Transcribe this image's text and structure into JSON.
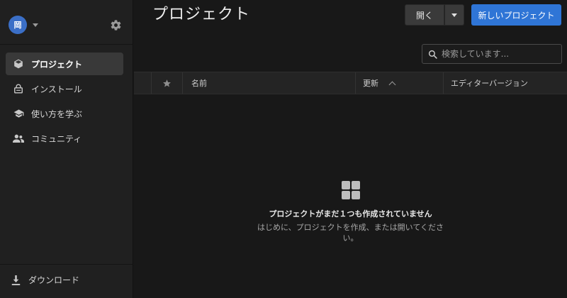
{
  "window": {
    "traffic_colors": [
      "#ff5f57",
      "#febc2e",
      "#28c840"
    ]
  },
  "account": {
    "avatar_initial": "岡",
    "avatar_color": "#3b6fc7"
  },
  "sidebar": {
    "items": [
      {
        "label": "プロジェクト",
        "icon": "cube-icon",
        "active": true
      },
      {
        "label": "インストール",
        "icon": "lock-icon",
        "active": false
      },
      {
        "label": "使い方を学ぶ",
        "icon": "graduation-cap-icon",
        "active": false
      },
      {
        "label": "コミュニティ",
        "icon": "people-icon",
        "active": false
      }
    ],
    "download_label": "ダウンロード"
  },
  "main": {
    "title": "プロジェクト",
    "open_label": "開く",
    "new_project_label": "新しいプロジェクト",
    "search_placeholder": "検索しています...",
    "columns": {
      "name": "名前",
      "updated": "更新",
      "editor_version": "エディターバージョン"
    },
    "empty_title": "プロジェクトがまだ１つも作成されていません",
    "empty_subtitle": "はじめに、プロジェクトを作成、または開いてください。"
  },
  "colors": {
    "accent": "#2f75d6",
    "background": "#181818",
    "sidebar": "#202020"
  }
}
